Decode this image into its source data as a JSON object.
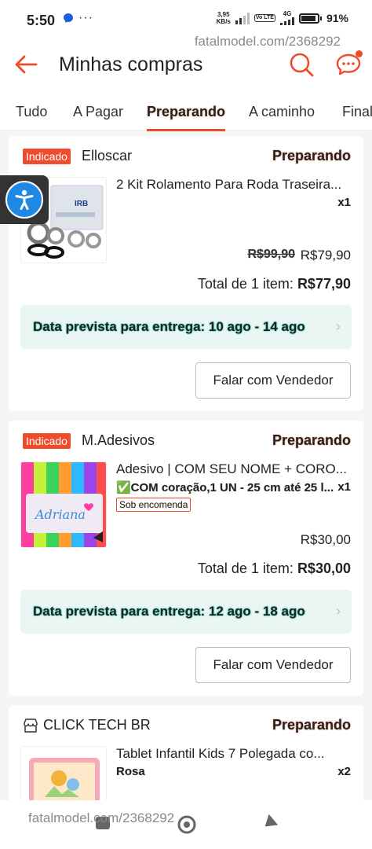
{
  "status_bar": {
    "time": "5:50",
    "network_speed": "3,95",
    "network_unit": "KB/s",
    "network_type": "4G",
    "volte": "Vo LTE",
    "battery": "91%"
  },
  "watermark": "fatalmodel.com/2368292",
  "header": {
    "title": "Minhas compras"
  },
  "tabs": [
    {
      "label": "Tudo"
    },
    {
      "label": "A Pagar"
    },
    {
      "label": "Preparando",
      "active": true
    },
    {
      "label": "A caminho"
    },
    {
      "label": "Final"
    }
  ],
  "orders": [
    {
      "badge": "Indicado",
      "shop": "Elloscar",
      "status": "Preparando",
      "title": "2 Kit Rolamento Para Roda Traseira...",
      "quantity": "x1",
      "old_price": "R$99,90",
      "price": "R$79,90",
      "total_label": "Total de 1 item:",
      "total_value": "R$77,90",
      "delivery": "Data prevista para entrega: 10 ago - 14 ago",
      "contact": "Falar com Vendedor"
    },
    {
      "badge": "Indicado",
      "shop": "M.Adesivos",
      "status": "Preparando",
      "title": "Adesivo | COM SEU NOME + CORO...",
      "variant": "✅COM coração,1 UN - 25 cm até 25 l...",
      "quantity": "x1",
      "tag": "Sob encomenda",
      "price": "R$30,00",
      "total_label": "Total de 1 item:",
      "total_value": "R$30,00",
      "delivery": "Data prevista para entrega: 12 ago - 18 ago",
      "contact": "Falar com Vendedor"
    },
    {
      "shop": "CLICK TECH BR",
      "status": "Preparando",
      "title": "Tablet Infantil Kids 7 Polegada co...",
      "variant": "Rosa",
      "quantity": "x2"
    }
  ],
  "colors": {
    "accent": "#ee4d2d",
    "delivery_bg": "#eaf6f3",
    "delivery_glow": "#26c6a5",
    "a11y_blue": "#1e88e5"
  }
}
